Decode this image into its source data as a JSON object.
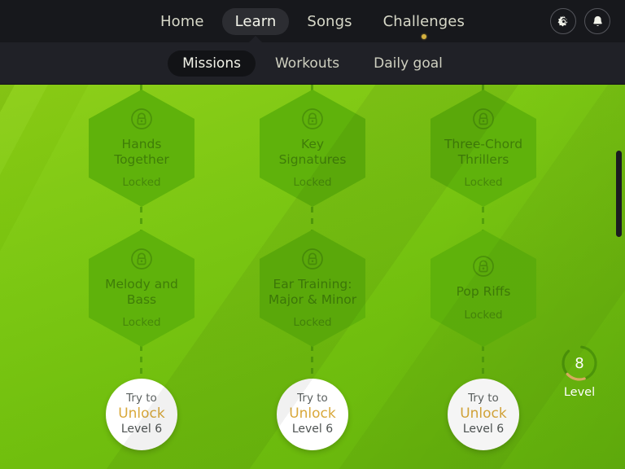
{
  "top_nav": {
    "items": [
      {
        "label": "Home",
        "active": false,
        "dot": false
      },
      {
        "label": "Learn",
        "active": true,
        "dot": false
      },
      {
        "label": "Songs",
        "active": false,
        "dot": false
      },
      {
        "label": "Challenges",
        "active": false,
        "dot": true
      }
    ],
    "icons": [
      {
        "name": "gear-icon",
        "label": "Settings"
      },
      {
        "name": "bell-icon",
        "label": "Notifications"
      }
    ]
  },
  "sub_nav": {
    "items": [
      {
        "label": "Missions",
        "active": true
      },
      {
        "label": "Workouts",
        "active": false
      },
      {
        "label": "Daily goal",
        "active": false
      }
    ]
  },
  "map": {
    "rows": [
      {
        "nodes": [
          {
            "type": "hex",
            "title": "Hands Together",
            "status": "Locked",
            "icon": "lock-icon"
          },
          {
            "type": "hex",
            "title": "Key Signatures",
            "status": "Locked",
            "icon": "lock-icon"
          },
          {
            "type": "hex",
            "title": "Three-Chord Thrillers",
            "status": "Locked",
            "icon": "lock-icon"
          }
        ]
      },
      {
        "nodes": [
          {
            "type": "hex",
            "title": "Melody and Bass",
            "status": "Locked",
            "icon": "lock-icon"
          },
          {
            "type": "hex",
            "title": "Ear Training: Major & Minor",
            "status": "Locked",
            "icon": "lock-icon"
          },
          {
            "type": "hex",
            "title": "Pop Riffs",
            "status": "Locked",
            "icon": "lock-icon"
          }
        ]
      },
      {
        "nodes": [
          {
            "type": "circle",
            "line1": "Try to",
            "line2": "Unlock",
            "line3": "Level 6"
          },
          {
            "type": "circle",
            "line1": "Try to",
            "line2": "Unlock",
            "line3": "Level 6"
          },
          {
            "type": "circle",
            "line1": "Try to",
            "line2": "Unlock",
            "line3": "Level 6"
          }
        ]
      }
    ]
  },
  "level_widget": {
    "value": "8",
    "label": "Level",
    "progress_percent": 18
  },
  "colors": {
    "nav_bg": "#17181c",
    "subnav_bg": "#202127",
    "map_green": "#74c40d",
    "hex_green": "#5fb20b",
    "hex_text": "#3f7d08",
    "accent_gold": "#d9a83a",
    "challenge_dot": "#d4b13f"
  }
}
